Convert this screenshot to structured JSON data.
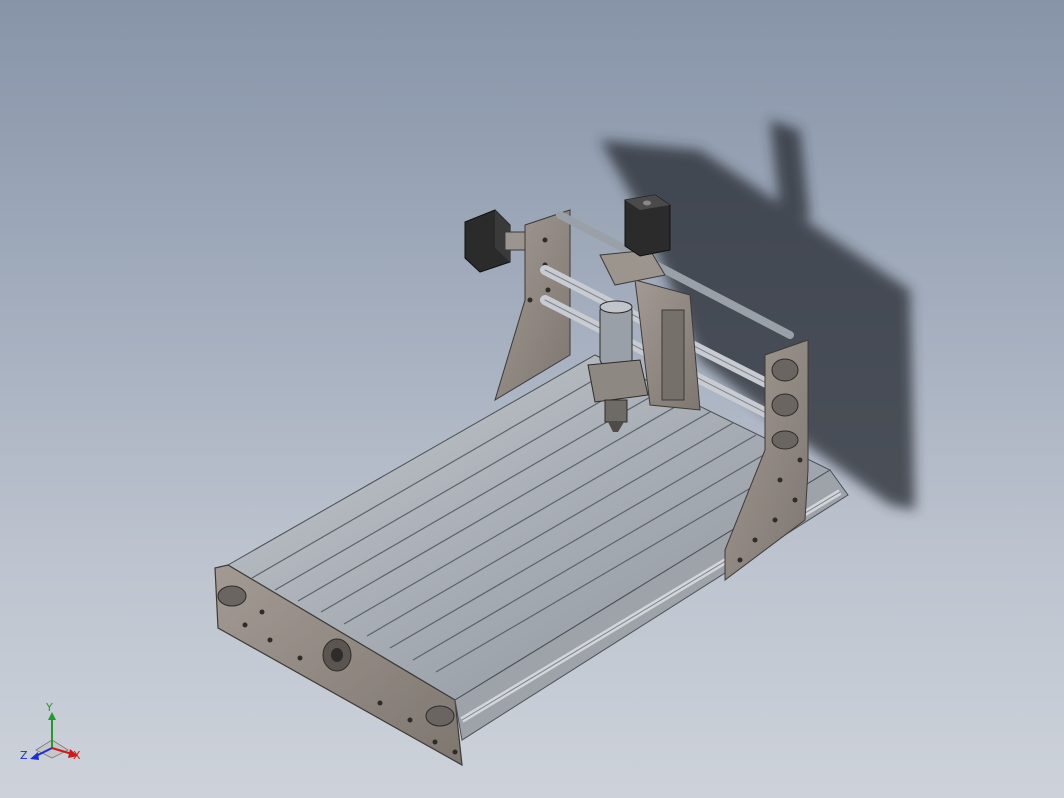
{
  "viewport": {
    "background_top": "#8794a8",
    "background_bottom": "#cdd2da"
  },
  "model": {
    "frame_color": "#8d8680",
    "rail_color": "#a8adb5",
    "motor_color": "#2b2b2b"
  },
  "triad": {
    "x_label": "X",
    "y_label": "Y",
    "z_label": "Z",
    "x_color": "#d21818",
    "y_color": "#1f9d2a",
    "z_color": "#1c2fd1"
  }
}
